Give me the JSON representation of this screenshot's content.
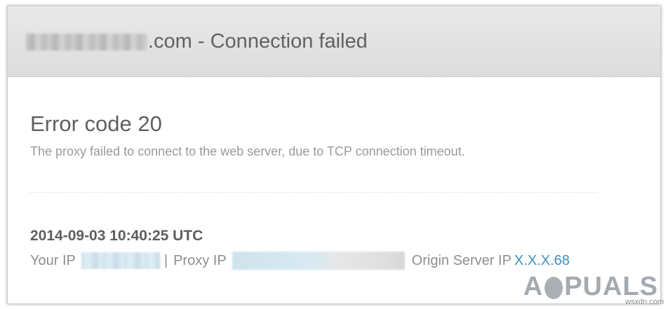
{
  "header": {
    "title_suffix": ".com - Connection failed"
  },
  "error": {
    "title": "Error code 20",
    "description": "The proxy failed to connect to the web server, due to TCP connection timeout."
  },
  "details": {
    "timestamp": "2014-09-03 10:40:25 UTC",
    "your_ip_label": "Your IP",
    "separator": "|",
    "proxy_ip_label": "Proxy IP",
    "origin_ip_label": "Origin Server IP",
    "origin_ip_value": "X.X.X.68"
  },
  "watermark": {
    "text_left": "A",
    "text_right": "PUALS",
    "site": "wsxdn.com"
  },
  "colors": {
    "header_bg": "#e2e2e2",
    "link": "#3e8fbf",
    "heading_text": "#5f5f5f",
    "muted_text": "#9a9a9a"
  }
}
